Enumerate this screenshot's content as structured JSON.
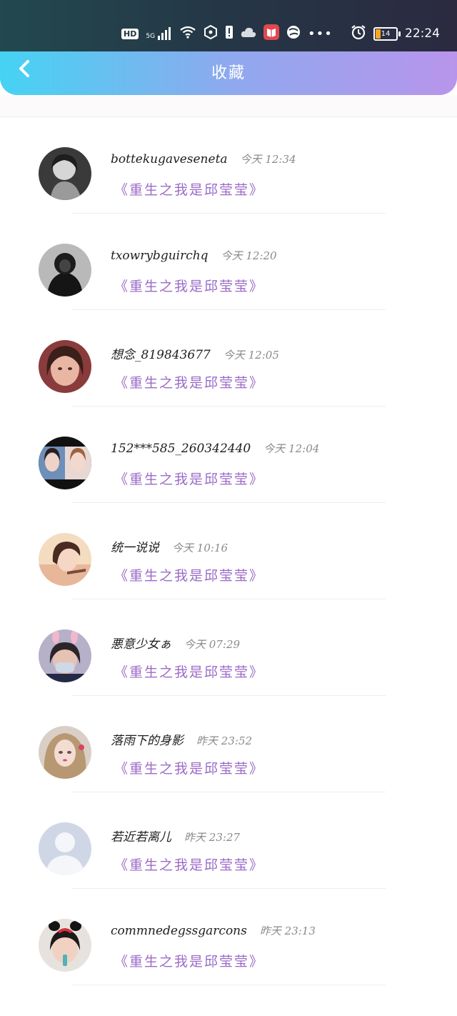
{
  "status_bar": {
    "network_badge": "HD",
    "network_type": "5G",
    "battery_level": "14",
    "time": "22:24"
  },
  "header": {
    "title": "收藏",
    "back_icon": "chevron-left-icon"
  },
  "items": [
    {
      "username": "bottekugaveseneta",
      "day": "今天",
      "time": "12:34",
      "book": "《重生之我是邱莹莹》"
    },
    {
      "username": "txowrybguirchq",
      "day": "今天",
      "time": "12:20",
      "book": "《重生之我是邱莹莹》"
    },
    {
      "username": "想念_819843677",
      "day": "今天",
      "time": "12:05",
      "book": "《重生之我是邱莹莹》"
    },
    {
      "username": "152***585_260342440",
      "day": "今天",
      "time": "12:04",
      "book": "《重生之我是邱莹莹》"
    },
    {
      "username": "统一说说",
      "day": "今天",
      "time": "10:16",
      "book": "《重生之我是邱莹莹》"
    },
    {
      "username": "悪意少女ぁ",
      "day": "今天",
      "time": "07:29",
      "book": "《重生之我是邱莹莹》"
    },
    {
      "username": "落雨下的身影",
      "day": "昨天",
      "time": "23:52",
      "book": "《重生之我是邱莹莹》"
    },
    {
      "username": "若近若离儿",
      "day": "昨天",
      "time": "23:27",
      "book": "《重生之我是邱莹莹》"
    },
    {
      "username": "commnedegssgarcons",
      "day": "昨天",
      "time": "23:13",
      "book": "《重生之我是邱莹莹》"
    }
  ]
}
